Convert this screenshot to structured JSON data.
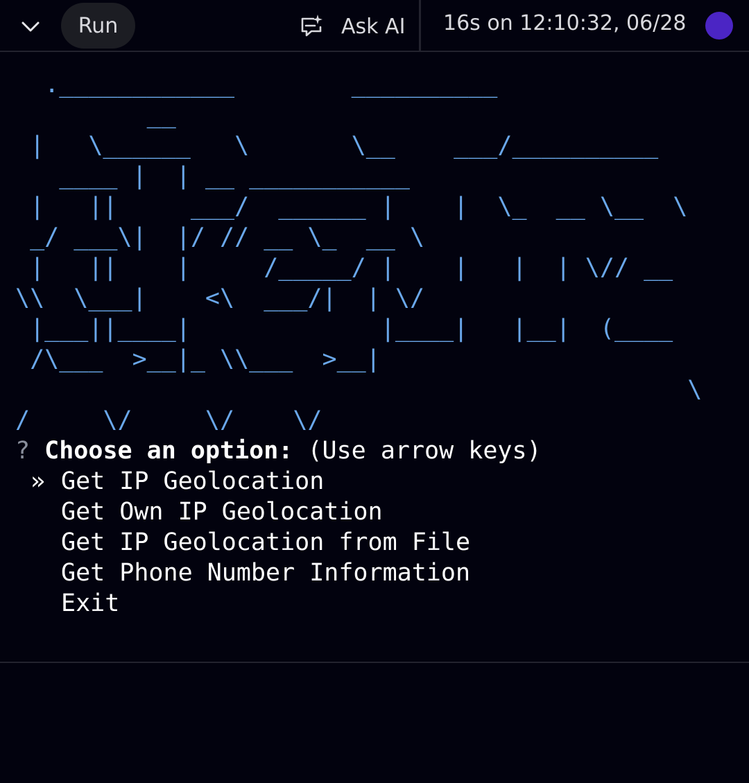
{
  "toolbar": {
    "collapse_icon": "chevron-down-icon",
    "run_label": "Run",
    "ask_ai_icon": "chat-sparkle-icon",
    "ask_ai_label": "Ask AI",
    "run_status": "16s on 12:10:32, 06/28",
    "avatar_color": "#4b25c4"
  },
  "console": {
    "banner_lines": [
      "  .____________        __________",
      "         __",
      " |   \\______   \\       \\__    ___/__________",
      "   ____ |  | __ ___________",
      " |   ||     ___/  ______ |    |  \\_  __ \\__  \\",
      " _/ ___\\|  |/ // __ \\_  __ \\",
      " |   ||    |     /_____/ |    |   |  | \\// __",
      "\\\\  \\___|    <\\  ___/|  | \\/",
      " |___||____|             |____|   |__|  (____",
      " /\\___  >__|_ \\\\___  >__|",
      "                                              \\",
      "/     \\/     \\/    \\/"
    ],
    "prompt_symbol": "?",
    "prompt_message": "Choose an option:",
    "prompt_hint": "(Use arrow keys)",
    "selection_pointer": "»",
    "options": [
      "Get IP Geolocation",
      "Get Own IP Geolocation",
      "Get IP Geolocation from File",
      "Get Phone Number Information",
      "Exit"
    ],
    "selected_index": 0
  },
  "colors": {
    "background": "#02020e",
    "banner": "#6aa7ea",
    "text": "#ffffff",
    "muted": "#8a8f9c"
  }
}
